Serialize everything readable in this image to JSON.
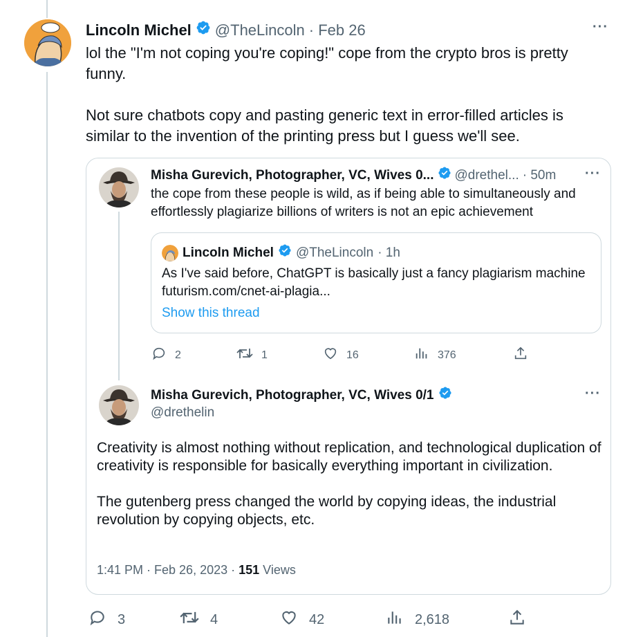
{
  "tweet": {
    "author_name": "Lincoln Michel",
    "handle": "@TheLincoln",
    "date": "· Feb 26",
    "text": "lol the \"I'm not coping you're coping!\" cope from the crypto bros is pretty funny.\n\nNot sure chatbots copy and pasting generic text in error-filled articles is similar to the invention of the printing press but I guess we'll see.",
    "more_label": "···",
    "replies": "3",
    "retweets": "4",
    "likes": "42",
    "views": "2,618"
  },
  "quote_reply": {
    "author_name": "Misha Gurevich, Photographer, VC, Wives 0...",
    "handle": "@drethel...",
    "time": "· 50m",
    "text": "the cope from these people is wild, as if being able to simultaneously and effortlessly plagiarize billions of writers is not an epic achievement",
    "more_label": "···",
    "replies": "2",
    "retweets": "1",
    "likes": "16",
    "views": "376"
  },
  "inner_quote": {
    "author_name": "Lincoln Michel",
    "handle": "@TheLincoln",
    "time": "· 1h",
    "text": "As I've said before, ChatGPT is basically just a fancy plagiarism machine futurism.com/cnet-ai-plagia...",
    "show_thread": "Show this thread"
  },
  "quoted_tweet": {
    "author_name": "Misha Gurevich, Photographer, VC, Wives 0/1",
    "handle": "@drethelin",
    "more_label": "···",
    "text": "Creativity is almost nothing without replication, and technological duplication of creativity is responsible for basically everything important in civilization.\n\nThe gutenberg press changed the world by copying ideas, the industrial revolution by copying objects, etc.",
    "timestamp": "1:41 PM · Feb 26, 2023 · ",
    "views_count": "151",
    "views_label": " Views"
  },
  "colors": {
    "accent": "#1d9bf0",
    "text": "#0f1419",
    "muted": "#536471",
    "border": "#cfd9de"
  },
  "icons": [
    "verified-badge-icon",
    "reply-icon",
    "retweet-icon",
    "like-icon",
    "views-icon",
    "share-icon",
    "more-icon"
  ]
}
